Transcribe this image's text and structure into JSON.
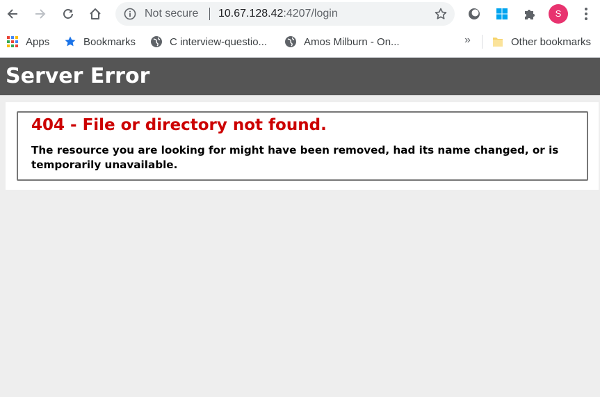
{
  "browser": {
    "omnibox": {
      "security_label": "Not secure",
      "url_host": "10.67.128.42",
      "url_rest": ":4207/login"
    },
    "profile_initial": "S",
    "accent_colors": {
      "avatar": "#e8336f",
      "star": "#1a73e8"
    }
  },
  "bookmarks_bar": {
    "items": [
      {
        "label": "Apps",
        "icon": "apps-grid-icon"
      },
      {
        "label": "Bookmarks",
        "icon": "star-icon"
      },
      {
        "label": "C interview-questio...",
        "icon": "globe-icon"
      },
      {
        "label": "Amos Milburn - On...",
        "icon": "globe-icon"
      }
    ],
    "overflow": "»",
    "other": {
      "label": "Other bookmarks",
      "icon": "folder-icon"
    }
  },
  "page": {
    "header_title": "Server Error",
    "error_heading": "404 - File or directory not found.",
    "error_message": "The resource you are looking for might have been removed, had its name changed, or is temporarily unavailable.",
    "colors": {
      "header_bg": "#555555",
      "error_red": "#cc0000",
      "page_bg": "#eeeeee"
    }
  }
}
